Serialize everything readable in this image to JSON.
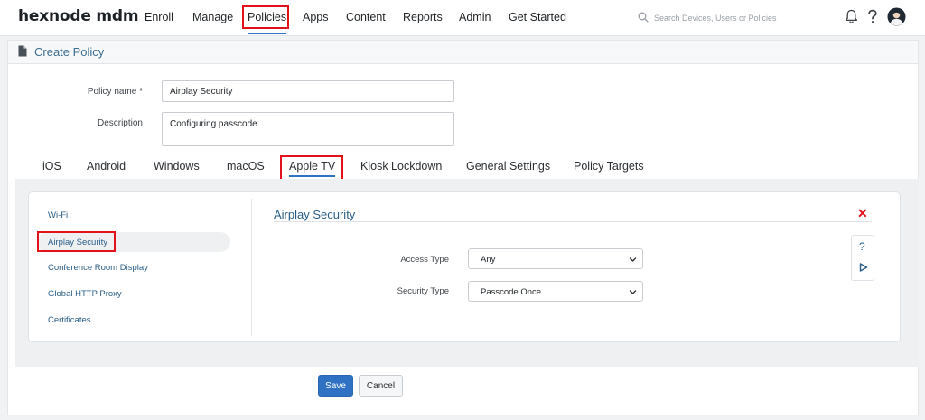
{
  "app": {
    "logo": "hexnode mdm"
  },
  "nav": {
    "items": [
      {
        "label": "Enroll"
      },
      {
        "label": "Manage"
      },
      {
        "label": "Policies"
      },
      {
        "label": "Apps"
      },
      {
        "label": "Content"
      },
      {
        "label": "Reports"
      },
      {
        "label": "Admin"
      },
      {
        "label": "Get Started"
      }
    ],
    "active": "Policies",
    "search_placeholder": "Search Devices, Users or Policies",
    "icons": [
      "search-icon",
      "bell-icon",
      "help-icon",
      "user-avatar"
    ]
  },
  "page": {
    "title": "Create Policy",
    "icon": "document-icon"
  },
  "form": {
    "policy_name_label": "Policy name *",
    "policy_name_value": "Airplay Security",
    "description_label": "Description",
    "description_value": "Configuring passcode"
  },
  "tabs": [
    {
      "label": "iOS"
    },
    {
      "label": "Android"
    },
    {
      "label": "Windows"
    },
    {
      "label": "macOS"
    },
    {
      "label": "Apple TV"
    },
    {
      "label": "Kiosk Lockdown"
    },
    {
      "label": "General Settings"
    },
    {
      "label": "Policy Targets"
    }
  ],
  "active_tab": "Apple TV",
  "sidebar": {
    "items": [
      {
        "label": "Wi-Fi"
      },
      {
        "label": "Airplay Security"
      },
      {
        "label": "Conference Room Display"
      },
      {
        "label": "Global HTTP Proxy"
      },
      {
        "label": "Certificates"
      }
    ],
    "active": "Airplay Security"
  },
  "section": {
    "title": "Airplay Security",
    "close_symbol": "✕",
    "access_type_label": "Access Type",
    "access_type_value": "Any",
    "security_type_label": "Security Type",
    "security_type_value": "Passcode Once",
    "help_symbol": "?"
  },
  "buttons": {
    "save": "Save",
    "cancel": "Cancel"
  },
  "colors": {
    "accent": "#2f72c4",
    "highlight": "#e2111a",
    "link": "#2a5d86"
  }
}
